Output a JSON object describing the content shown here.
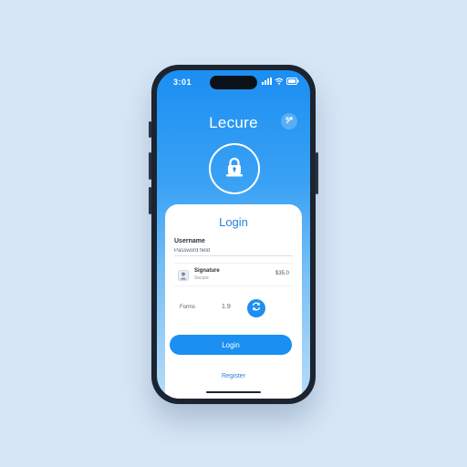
{
  "status_bar": {
    "time": "3:01"
  },
  "app": {
    "title": "Lecure"
  },
  "login_card": {
    "title": "Login",
    "username_label": "Username",
    "username_value": "Password field",
    "user_row": {
      "name": "Signature",
      "sub": "Secure",
      "value": "$35.0"
    },
    "options": {
      "label": "Forms",
      "value": "1.9"
    },
    "login_button_label": "Login",
    "register_link_label": "Register"
  },
  "colors": {
    "accent": "#1b8ff2",
    "background": "#d7e6f6",
    "frame": "#1c2430"
  },
  "icons": {
    "settings": "settings-icon",
    "lock": "lock-icon",
    "avatar": "avatar-icon",
    "refresh": "refresh-icon"
  }
}
